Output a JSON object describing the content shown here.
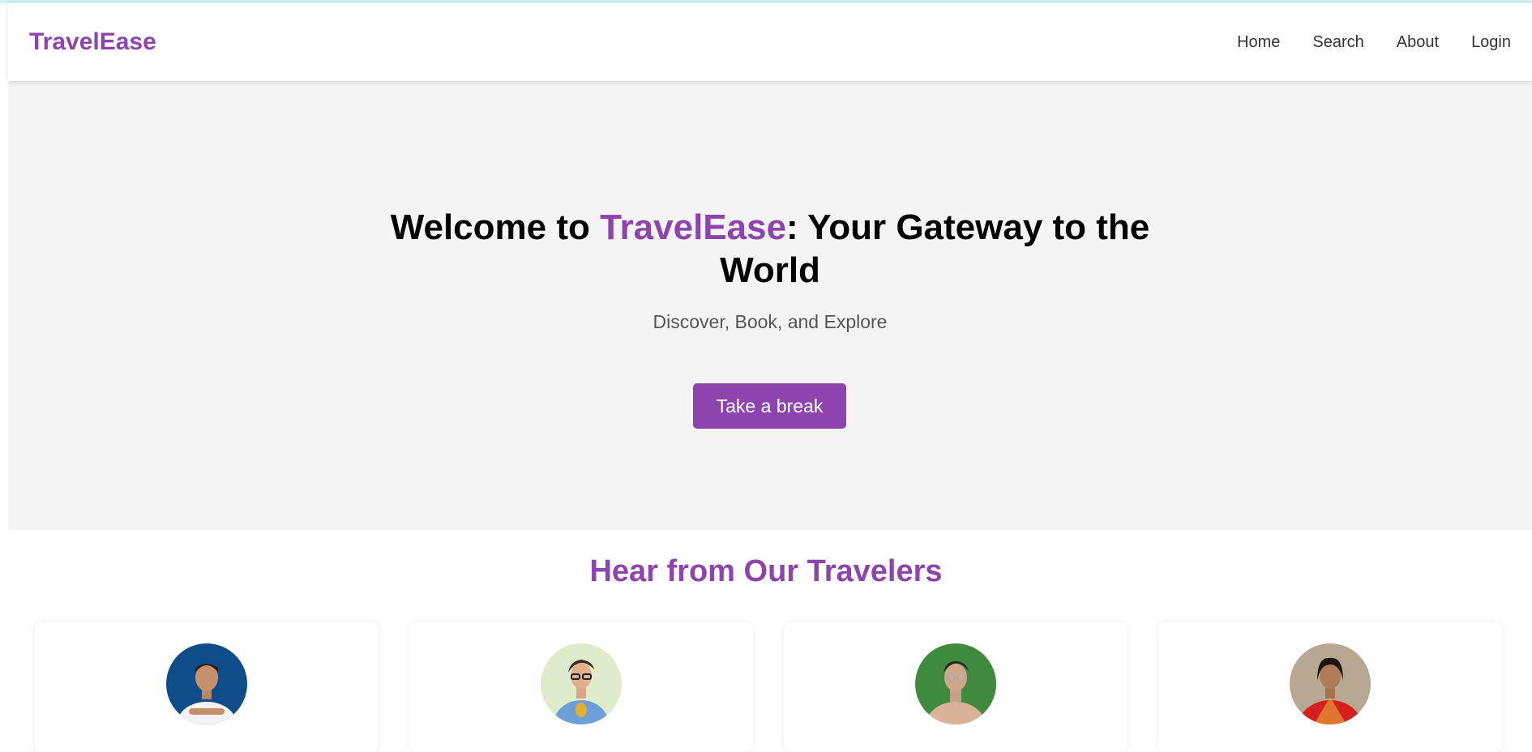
{
  "header": {
    "brand": "TravelEase",
    "nav": [
      {
        "label": "Home"
      },
      {
        "label": "Search"
      },
      {
        "label": "About"
      },
      {
        "label": "Login"
      }
    ]
  },
  "hero": {
    "title_prefix": "Welcome to ",
    "title_brand": "TravelEase",
    "title_suffix": ": Your Gateway to the World",
    "subtitle": "Discover, Book, and Explore",
    "cta_label": "Take a break"
  },
  "testimonials": {
    "title": "Hear from Our Travelers",
    "items": [
      {
        "avatar": "traveler-avatar-1",
        "bg": "#0f4c8a"
      },
      {
        "avatar": "traveler-avatar-2",
        "bg": "#d9e9c4"
      },
      {
        "avatar": "traveler-avatar-3",
        "bg": "#3f8a3f"
      },
      {
        "avatar": "traveler-avatar-4",
        "bg": "#b7a892"
      }
    ]
  },
  "colors": {
    "brand": "#8e44ad",
    "hero_bg": "#f4f4f4"
  }
}
